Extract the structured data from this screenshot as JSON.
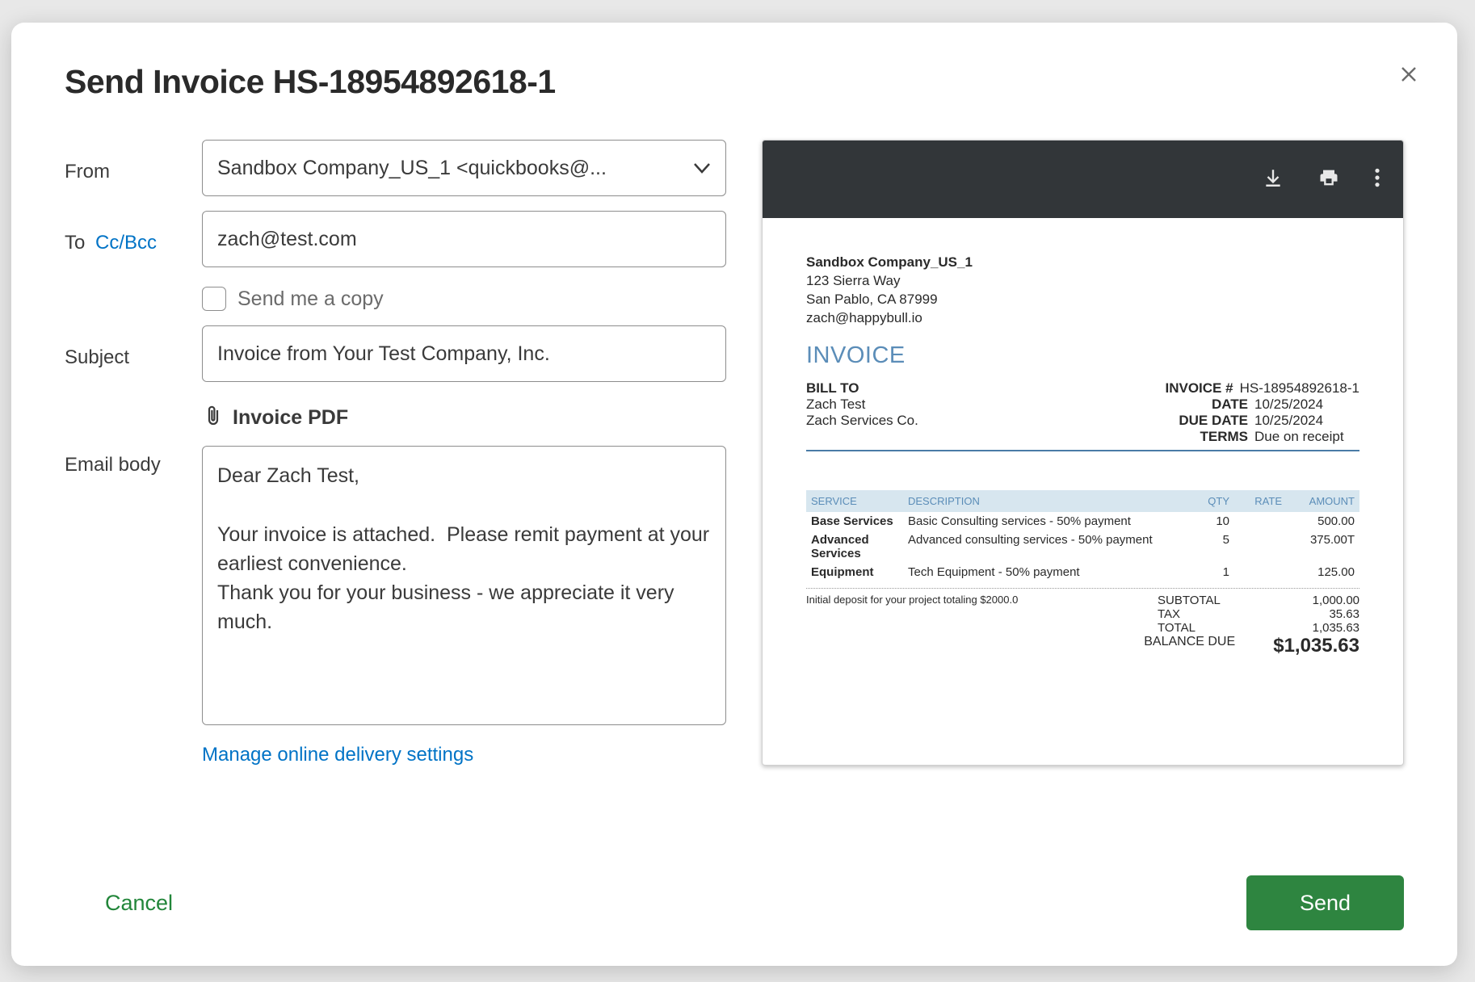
{
  "modal": {
    "title": "Send Invoice HS-18954892618-1",
    "close_label": "✕"
  },
  "form": {
    "from_label": "From",
    "from_value": "Sandbox Company_US_1 <quickbooks@...",
    "to_label": "To",
    "ccbcc_label": "Cc/Bcc",
    "to_value": "zach@test.com",
    "sendcopy_label": "Send me a copy",
    "subject_label": "Subject",
    "subject_value": "Invoice from Your Test Company, Inc.",
    "attachment_label": "Invoice PDF",
    "body_label": "Email body",
    "body_value": "Dear Zach Test,\n\nYour invoice is attached.  Please remit payment at your earliest convenience.\nThank you for your business - we appreciate it very much.",
    "manage_link": "Manage online delivery settings"
  },
  "preview": {
    "company": {
      "name": "Sandbox Company_US_1",
      "addr1": "123 Sierra Way",
      "addr2": "San Pablo, CA  87999",
      "email": "zach@happybull.io"
    },
    "invoice_title": "INVOICE",
    "billto": {
      "label": "BILL TO",
      "name": "Zach Test",
      "company": "Zach Services Co."
    },
    "meta": {
      "invoice_num_label": "INVOICE #",
      "invoice_num": "HS-18954892618-1",
      "date_label": "DATE",
      "date": "10/25/2024",
      "due_label": "DUE DATE",
      "due": "10/25/2024",
      "terms_label": "TERMS",
      "terms": "Due on receipt"
    },
    "table": {
      "headers": {
        "service": "SERVICE",
        "desc": "DESCRIPTION",
        "qty": "QTY",
        "rate": "RATE",
        "amount": "AMOUNT"
      },
      "rows": [
        {
          "service": "Base Services",
          "desc": "Basic Consulting services - 50% payment",
          "qty": "10",
          "rate": "",
          "amount": "500.00"
        },
        {
          "service": "Advanced Services",
          "desc": "Advanced consulting services - 50% payment",
          "qty": "5",
          "rate": "",
          "amount": "375.00T"
        },
        {
          "service": "Equipment",
          "desc": "Tech Equipment - 50% payment",
          "qty": "1",
          "rate": "",
          "amount": "125.00"
        }
      ]
    },
    "deposit_note": "Initial deposit for your project totaling $2000.0",
    "totals": {
      "subtotal_label": "SUBTOTAL",
      "subtotal": "1,000.00",
      "tax_label": "TAX",
      "tax": "35.63",
      "total_label": "TOTAL",
      "total": "1,035.63",
      "balance_label": "BALANCE DUE",
      "balance": "$1,035.63"
    }
  },
  "footer": {
    "cancel": "Cancel",
    "send": "Send"
  }
}
